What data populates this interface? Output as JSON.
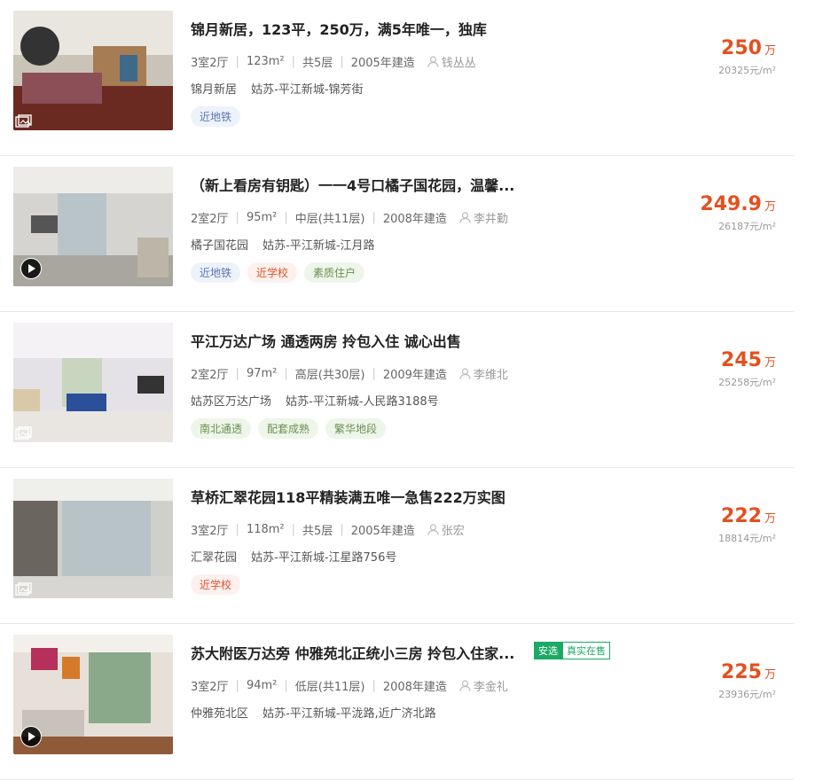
{
  "listings": [
    {
      "title": "锦月新居，123平，250万，满5年唯一，独库",
      "layout": "3室2厅",
      "area": "123m²",
      "floor": "共5层",
      "year": "2005年建造",
      "agent": "钱丛丛",
      "community": "锦月新居",
      "district": "姑苏-平江新城-锦芳街",
      "tags": [
        "近地铁"
      ],
      "total": "250",
      "total_unit": "万",
      "unit_price": "20325元/m²",
      "media": "photo-icon"
    },
    {
      "title": "（新上看房有钥匙）一一4号口橘子国花园，温馨...",
      "layout": "2室2厅",
      "area": "95m²",
      "floor": "中层(共11层)",
      "year": "2008年建造",
      "agent": "李井勤",
      "community": "橘子国花园",
      "district": "姑苏-平江新城-江月路",
      "tags": [
        "近地铁",
        "近学校",
        "素质住户"
      ],
      "total": "249.9",
      "total_unit": "万",
      "unit_price": "26187元/m²",
      "media": "play-icon"
    },
    {
      "title": "平江万达广场 通透两房 拎包入住 诚心出售",
      "layout": "2室2厅",
      "area": "97m²",
      "floor": "高层(共30层)",
      "year": "2009年建造",
      "agent": "李维北",
      "community": "姑苏区万达广场",
      "district": "姑苏-平江新城-人民路3188号",
      "tags": [
        "南北通透",
        "配套成熟",
        "繁华地段"
      ],
      "total": "245",
      "total_unit": "万",
      "unit_price": "25258元/m²",
      "media": "photo-icon"
    },
    {
      "title": "草桥汇翠花园118平精装满五唯一急售222万实图",
      "layout": "3室2厅",
      "area": "118m²",
      "floor": "共5层",
      "year": "2005年建造",
      "agent": "张宏",
      "community": "汇翠花园",
      "district": "姑苏-平江新城-江星路756号",
      "tags": [
        "近学校"
      ],
      "total": "222",
      "total_unit": "万",
      "unit_price": "18814元/m²",
      "media": "photo-icon"
    },
    {
      "title": "苏大附医万达旁 仲雅苑北正统小三房 拎包入住家...",
      "title_badges": [
        "安选",
        "真实在售"
      ],
      "layout": "3室2厅",
      "area": "94m²",
      "floor": "低层(共11层)",
      "year": "2008年建造",
      "agent": "李金礼",
      "community": "仲雅苑北区",
      "district": "姑苏-平江新城-平泷路,近广济北路",
      "tags": [],
      "total": "225",
      "total_unit": "万",
      "unit_price": "23936元/m²",
      "media": "play-icon"
    }
  ],
  "colors": {
    "price": "#e4501f",
    "tag_blue": "#5877b2",
    "tag_red": "#e0532b",
    "tag_green": "#6b8f4f",
    "badge_green": "#1aaa64"
  }
}
